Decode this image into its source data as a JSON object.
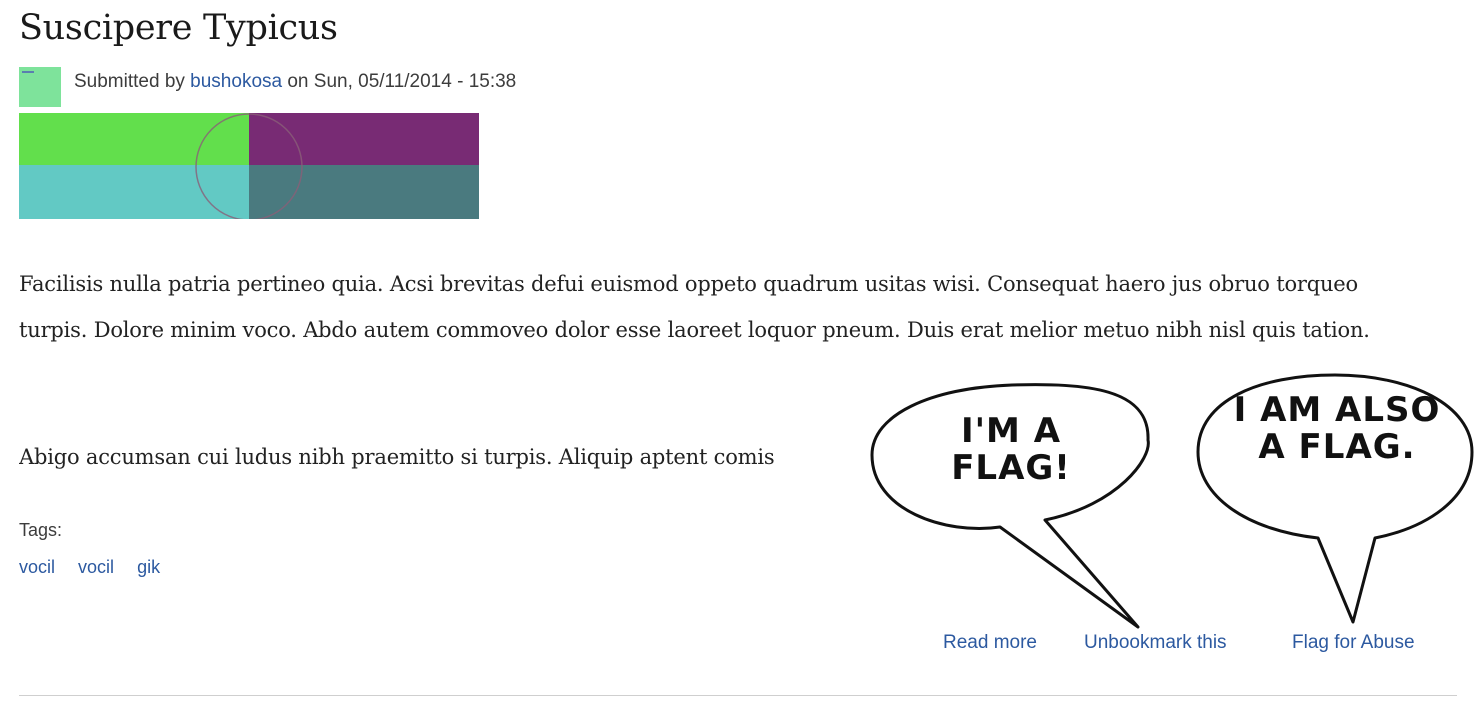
{
  "node": {
    "title": "Suscipere Typicus",
    "submitted_prefix": "Submitted by ",
    "author": "bushokosa",
    "submitted_suffix": " on Sun, 05/11/2014 - 15:38",
    "body_paragraph_1": "Facilisis nulla patria pertineo quia. Acsi brevitas defui euismod oppeto quadrum usitas wisi. Consequat haero jus obruo torqueo turpis. Dolore minim voco. Abdo autem commoveo dolor esse laoreet loquor pneum. Duis erat melior metuo nibh nisl quis tation.",
    "body_paragraph_2": "Abigo accumsan cui ludus nibh praemitto si turpis. Aliquip aptent comis",
    "tags_label": "Tags:",
    "tags": [
      "vocil",
      "vocil",
      "gik"
    ]
  },
  "links": {
    "read_more": "Read more",
    "unbookmark": "Unbookmark this",
    "flag_abuse": "Flag for Abuse"
  },
  "callouts": {
    "bubble_1": "I'm a flag!",
    "bubble_2": "I am also a flag."
  },
  "colors": {
    "link": "#2c59a0",
    "image_green": "#62df4c",
    "image_purple": "#782b74",
    "image_teal": "#62c9c4",
    "image_slate": "#4a7a7f",
    "avatar": "#7ee39b"
  }
}
